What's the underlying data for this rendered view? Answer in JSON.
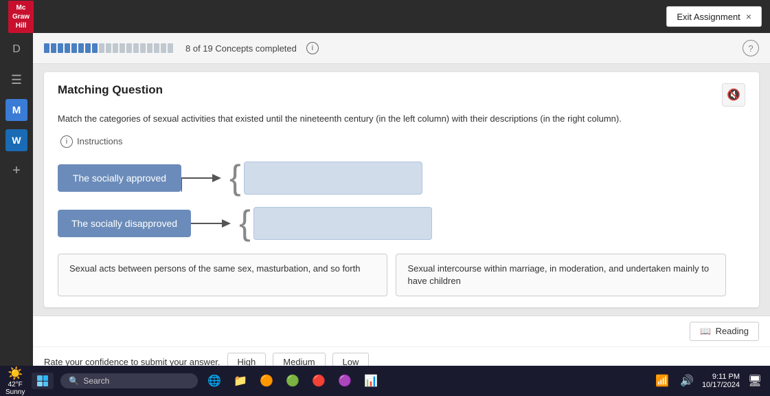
{
  "topbar": {
    "logo_line1": "Mc",
    "logo_line2": "Graw",
    "logo_line3": "Hill",
    "exit_button": "Exit Assignment",
    "exit_icon": "×"
  },
  "sidebar": {
    "items": [
      {
        "label": "D",
        "type": "text"
      },
      {
        "label": "m",
        "type": "text"
      },
      {
        "label": "M",
        "type": "m-icon"
      },
      {
        "label": "W",
        "type": "w-icon"
      },
      {
        "label": "+",
        "type": "plus-icon"
      }
    ]
  },
  "progress": {
    "text": "8 of 19 Concepts completed",
    "info_label": "i",
    "help_label": "?"
  },
  "question": {
    "title": "Matching Question",
    "audio_icon": "🔇",
    "instruction_text": "Match the categories of sexual activities that existed until the nineteenth century (in the left column) with their descriptions (in the right column).",
    "instructions_toggle": "Instructions",
    "left_items": [
      {
        "label": "The socially approved"
      },
      {
        "label": "The socially disapproved"
      }
    ],
    "answer_options": [
      {
        "text": "Sexual acts between persons of the same sex, masturbation, and so forth"
      },
      {
        "text": "Sexual intercourse within marriage, in moderation, and undertaken mainly to have children"
      }
    ]
  },
  "bottom": {
    "rate_text": "Rate your confidence to submit your answer.",
    "buttons": [
      {
        "label": "High"
      },
      {
        "label": "Medium"
      },
      {
        "label": "Low"
      }
    ],
    "reading_btn": "Reading",
    "reading_icon": "📖"
  },
  "taskbar": {
    "weather_temp": "42°F",
    "weather_condition": "Sunny",
    "search_placeholder": "Search",
    "time": "9:11 PM",
    "date": "10/17/2024"
  }
}
